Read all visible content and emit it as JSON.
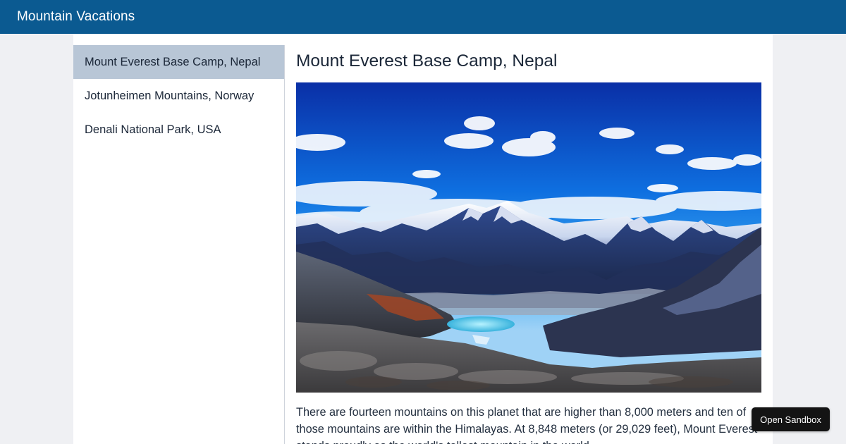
{
  "header": {
    "title": "Mountain Vacations"
  },
  "sidebar": {
    "items": [
      {
        "label": "Mount Everest Base Camp, Nepal",
        "active": true
      },
      {
        "label": "Jotunheimen Mountains, Norway",
        "active": false
      },
      {
        "label": "Denali National Park, USA",
        "active": false
      }
    ]
  },
  "main": {
    "title": "Mount Everest Base Camp, Nepal",
    "image_subject": "snow-capped Himalayan mountain range under blue sky with clouds, glacial valley and turquoise lake",
    "description": "There are fourteen mountains on this planet that are higher than 8,000 meters and ten of those mountains are within the Himalayas. At 8,848 meters (or 29,029 feet), Mount Everest stands proudly as the world's tallest mountain in the world."
  },
  "sandbox": {
    "label": "Open Sandbox"
  },
  "colors": {
    "header_bg": "#0b5a91",
    "active_nav_bg": "#b8c6d6",
    "page_bg": "#eff0f3"
  }
}
